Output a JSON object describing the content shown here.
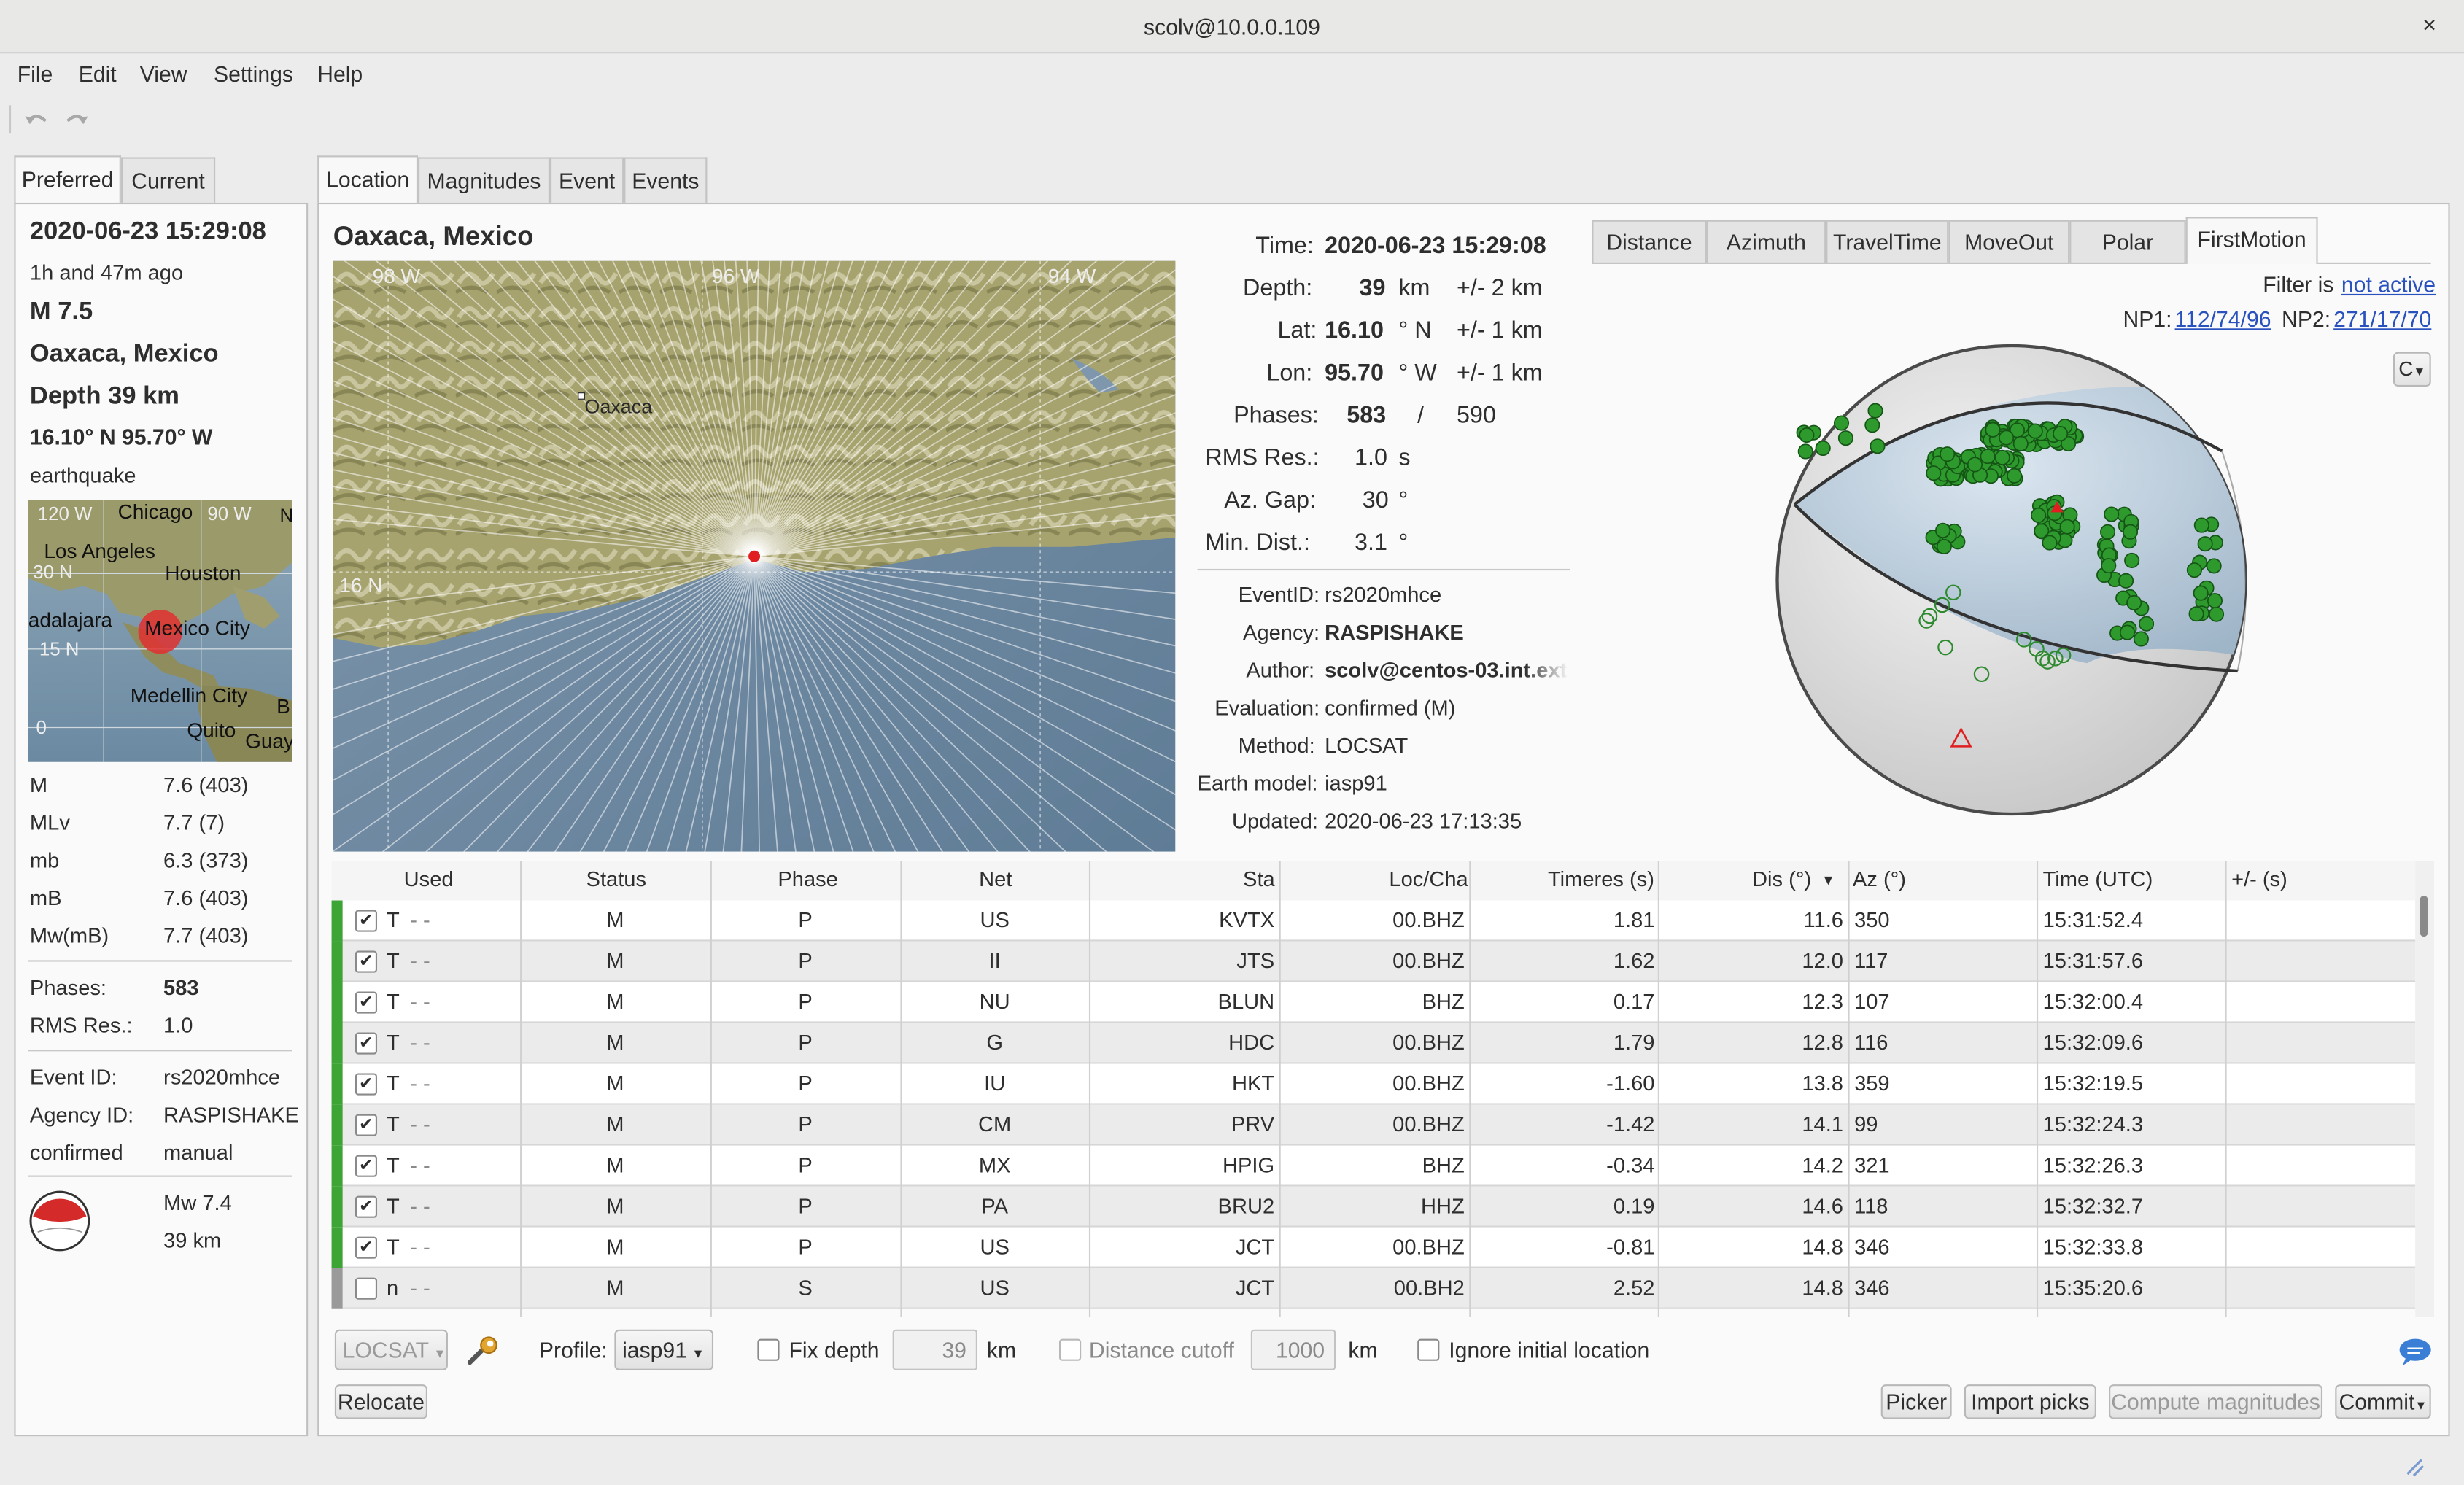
{
  "window": {
    "title": "scolv@10.0.0.109",
    "close": "×"
  },
  "menu": [
    "File",
    "Edit",
    "View",
    "Settings",
    "Help"
  ],
  "left_tabs": [
    "Preferred",
    "Current"
  ],
  "summary": {
    "time": "2020-06-23 15:29:08",
    "ago": "1h and 47m ago",
    "mag": "M 7.5",
    "region": "Oaxaca, Mexico",
    "depth": "Depth  39 km",
    "coords": "16.10° N  95.70° W",
    "type": "earthquake",
    "map_labels": {
      "lon1": "120 W",
      "lon2": "90 W",
      "chicago": "Chicago",
      "la": "Los Angeles",
      "houston": "Houston",
      "lat30": "30 N",
      "guadalajara": "adalajara",
      "mexico": "Mexico City",
      "lat15": "15 N",
      "medellin": "Medellin City",
      "zero": "0",
      "quito": "Quito",
      "guay": "Guay",
      "n": "N",
      "b": "B"
    },
    "mags": [
      {
        "k": "M",
        "v": "7.6 (403)"
      },
      {
        "k": "MLv",
        "v": "7.7 (7)"
      },
      {
        "k": "mb",
        "v": "6.3 (373)"
      },
      {
        "k": "mB",
        "v": "7.6 (403)"
      },
      {
        "k": "Mw(mB)",
        "v": "7.7 (403)"
      }
    ],
    "phases_k": "Phases:",
    "phases_v": "583",
    "rms_k": "RMS Res.:",
    "rms_v": "1.0",
    "eventid_k": "Event ID:",
    "eventid_v": "rs2020mhce",
    "agency_k": "Agency ID:",
    "agency_v": "RASPISHAKE",
    "status_k": "confirmed",
    "status_v": "manual",
    "fm_mag": "Mw 7.4",
    "fm_depth": "39 km"
  },
  "main_tabs": [
    "Location",
    "Magnitudes",
    "Event",
    "Events"
  ],
  "location": {
    "region": "Oaxaca, Mexico",
    "map": {
      "lon98": "98 W",
      "lon96": "96 W",
      "lon94": "94 W",
      "lat16": "16 N",
      "city": "Oaxaca"
    },
    "info": [
      {
        "k": "Time:",
        "v": "2020-06-23 15:29:08",
        "u": "",
        "e": ""
      },
      {
        "k": "Depth:",
        "v": "39",
        "u": "km",
        "e": "+/-  2  km"
      },
      {
        "k": "Lat:",
        "v": "16.10",
        "u": "° N",
        "e": "+/-  1  km"
      },
      {
        "k": "Lon:",
        "v": "95.70",
        "u": "° W",
        "e": "+/-  1  km"
      },
      {
        "k": "Phases:",
        "v": "583",
        "u": "/",
        "e": "590"
      },
      {
        "k": "RMS Res.:",
        "v": "1.0",
        "u": "s",
        "e": ""
      },
      {
        "k": "Az. Gap:",
        "v": "30",
        "u": "°",
        "e": ""
      },
      {
        "k": "Min. Dist.:",
        "v": "3.1",
        "u": "°",
        "e": ""
      }
    ],
    "meta": [
      {
        "k": "EventID:",
        "v": "rs2020mhce"
      },
      {
        "k": "Agency:",
        "v": "RASPISHAKE"
      },
      {
        "k": "Author:",
        "v": "scolv@centos-03.int.ext"
      },
      {
        "k": "Evaluation:",
        "v": "confirmed (M)"
      },
      {
        "k": "Method:",
        "v": "LOCSAT"
      },
      {
        "k": "Earth model:",
        "v": "iasp91"
      },
      {
        "k": "Updated:",
        "v": "2020-06-23 17:13:35"
      }
    ]
  },
  "plot_tabs": [
    "Distance",
    "Azimuth",
    "TravelTime",
    "MoveOut",
    "Polar",
    "FirstMotion"
  ],
  "plot": {
    "filter_label": "Filter is",
    "filter_value": "not active",
    "np1_label": "NP1:",
    "np1": "112/74/96",
    "np2_label": "NP2:",
    "np2": "271/17/70",
    "menu_btn": "C"
  },
  "table": {
    "headers": [
      "Used",
      "Status",
      "Phase",
      "Net",
      "Sta",
      "Loc/Cha",
      "Timeres (s)",
      "Dis (°)",
      "Az (°)",
      "Time (UTC)",
      "+/- (s)"
    ],
    "rows": [
      {
        "used": "T",
        "st": "M",
        "ph": "P",
        "net": "US",
        "sta": "KVTX",
        "cha": "00.BHZ",
        "res": "1.81",
        "dis": "11.6",
        "az": "350",
        "time": "15:31:52.4",
        "checked": true
      },
      {
        "used": "T",
        "st": "M",
        "ph": "P",
        "net": "II",
        "sta": "JTS",
        "cha": "00.BHZ",
        "res": "1.62",
        "dis": "12.0",
        "az": "117",
        "time": "15:31:57.6",
        "checked": true
      },
      {
        "used": "T",
        "st": "M",
        "ph": "P",
        "net": "NU",
        "sta": "BLUN",
        "cha": "BHZ",
        "res": "0.17",
        "dis": "12.3",
        "az": "107",
        "time": "15:32:00.4",
        "checked": true
      },
      {
        "used": "T",
        "st": "M",
        "ph": "P",
        "net": "G",
        "sta": "HDC",
        "cha": "00.BHZ",
        "res": "1.79",
        "dis": "12.8",
        "az": "116",
        "time": "15:32:09.6",
        "checked": true
      },
      {
        "used": "T",
        "st": "M",
        "ph": "P",
        "net": "IU",
        "sta": "HKT",
        "cha": "00.BHZ",
        "res": "-1.60",
        "dis": "13.8",
        "az": "359",
        "time": "15:32:19.5",
        "checked": true
      },
      {
        "used": "T",
        "st": "M",
        "ph": "P",
        "net": "CM",
        "sta": "PRV",
        "cha": "00.BHZ",
        "res": "-1.42",
        "dis": "14.1",
        "az": "99",
        "time": "15:32:24.3",
        "checked": true
      },
      {
        "used": "T",
        "st": "M",
        "ph": "P",
        "net": "MX",
        "sta": "HPIG",
        "cha": "BHZ",
        "res": "-0.34",
        "dis": "14.2",
        "az": "321",
        "time": "15:32:26.3",
        "checked": true
      },
      {
        "used": "T",
        "st": "M",
        "ph": "P",
        "net": "PA",
        "sta": "BRU2",
        "cha": "HHZ",
        "res": "0.19",
        "dis": "14.6",
        "az": "118",
        "time": "15:32:32.7",
        "checked": true
      },
      {
        "used": "T",
        "st": "M",
        "ph": "P",
        "net": "US",
        "sta": "JCT",
        "cha": "00.BHZ",
        "res": "-0.81",
        "dis": "14.8",
        "az": "346",
        "time": "15:32:33.8",
        "checked": true
      },
      {
        "used": "n",
        "st": "M",
        "ph": "S",
        "net": "US",
        "sta": "JCT",
        "cha": "00.BH2",
        "res": "2.52",
        "dis": "14.8",
        "az": "346",
        "time": "15:35:20.6",
        "checked": false
      }
    ],
    "dash": "-  -"
  },
  "bottom": {
    "locator": "LOCSAT",
    "profile_label": "Profile:",
    "profile": "iasp91",
    "fix_depth": "Fix depth",
    "depth_val": "39",
    "km": "km",
    "dist_cutoff": "Distance cutoff",
    "dist_val": "1000",
    "ignore": "Ignore initial location",
    "relocate": "Relocate",
    "picker": "Picker",
    "import": "Import picks",
    "compute": "Compute magnitudes",
    "commit": "Commit"
  },
  "colors": {
    "used_bar": "#3da535",
    "unused_bar": "#9a9a9a",
    "station_fill": "#2e9a2e",
    "accent_link": "#2a52be"
  }
}
